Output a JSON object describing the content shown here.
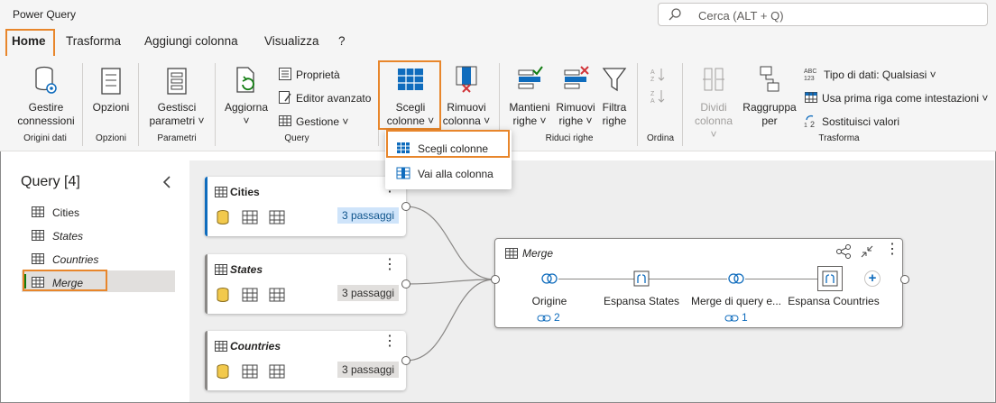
{
  "app_title": "Power Query",
  "search": {
    "placeholder": "Cerca (ALT + Q)"
  },
  "tabs": [
    "Home",
    "Trasforma",
    "Aggiungi colonna",
    "Visualizza",
    "?"
  ],
  "ribbon": {
    "manage_connections": [
      "Gestire",
      "connessioni"
    ],
    "options": "Opzioni",
    "manage_parameters": [
      "Gestisci",
      "parametri ˅"
    ],
    "refresh": [
      "Aggiorna",
      "˅"
    ],
    "properties": "Proprietà",
    "advanced_editor": "Editor avanzato",
    "manage": "Gestione ˅",
    "choose_columns": [
      "Scegli",
      "colonne ˅"
    ],
    "remove_columns": [
      "Rimuovi",
      "colonna ˅"
    ],
    "keep_rows": [
      "Mantieni",
      "righe ˅"
    ],
    "remove_rows": [
      "Rimuovi",
      "righe ˅"
    ],
    "filter_rows": [
      "Filtra",
      "righe"
    ],
    "split_column": [
      "Dividi",
      "colonna ˅"
    ],
    "group_by": [
      "Raggruppa",
      "per"
    ],
    "data_type": "Tipo di dati: Qualsiasi ˅",
    "use_first_row": "Usa prima riga come intestazioni ˅",
    "replace_values": "Sostituisci valori",
    "sort_icon_label": "",
    "groups": {
      "data_sources": "Origini dati",
      "options": "Opzioni",
      "parameters": "Parametri",
      "query": "Query",
      "reduce_rows": "Riduci righe",
      "sort": "Ordina",
      "transform": "Trasforma"
    }
  },
  "dropdown": {
    "choose_columns": "Scegli colonne",
    "go_to_column": "Vai alla colonna"
  },
  "queries_pane": {
    "title": "Query [4]",
    "items": [
      "Cities",
      "States",
      "Countries",
      "Merge"
    ]
  },
  "cards": [
    {
      "title": "Cities",
      "steps": "3 passaggi"
    },
    {
      "title": "States",
      "steps": "3 passaggi"
    },
    {
      "title": "Countries",
      "steps": "3 passaggi"
    }
  ],
  "merge": {
    "title": "Merge",
    "steps": [
      "Origine",
      "Espansa States",
      "Merge di query e...",
      "Espansa Countries"
    ],
    "refs": [
      "2",
      "1"
    ]
  },
  "colors": {
    "accent": "#0f6cbd",
    "highlight": "#e8862b",
    "cities_bar": "#0f6cbd",
    "other_bar": "#8a8886"
  }
}
